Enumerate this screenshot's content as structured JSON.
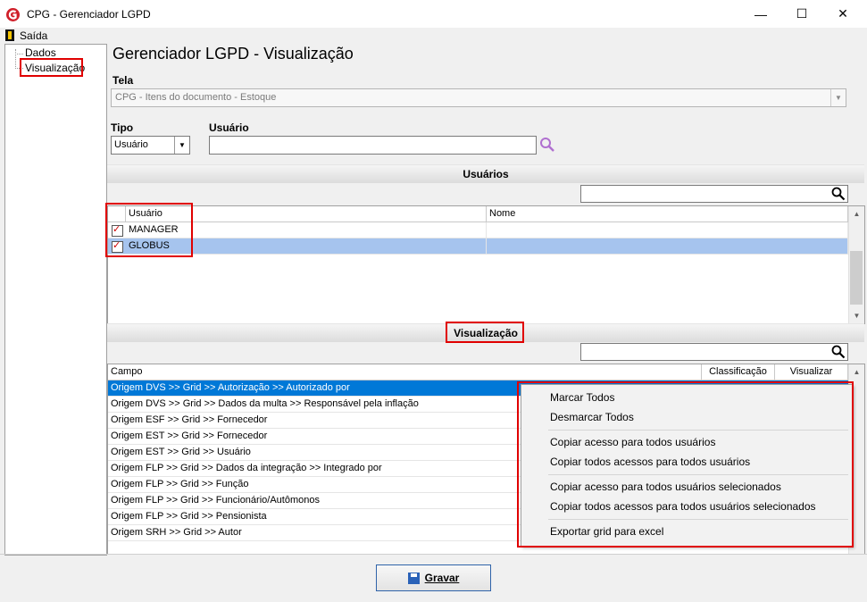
{
  "window": {
    "title": "CPG - Gerenciador LGPD",
    "minimize": "—",
    "maximize": "☐",
    "close": "✕"
  },
  "menu": {
    "saida": "Saída"
  },
  "tree": {
    "items": [
      {
        "label": "Dados"
      },
      {
        "label": "Visualização"
      }
    ]
  },
  "page": {
    "title": "Gerenciador LGPD - Visualização"
  },
  "tela": {
    "label": "Tela",
    "value": "CPG - Itens do documento - Estoque"
  },
  "tipo": {
    "label": "Tipo",
    "value": "Usuário"
  },
  "usuario": {
    "label": "Usuário",
    "value": ""
  },
  "usuarios_section": {
    "title": "Usuários",
    "search_value": "",
    "columns": [
      "Usuário",
      "Nome"
    ],
    "rows": [
      {
        "usuario": "MANAGER",
        "nome": "",
        "checked": true,
        "selected": false
      },
      {
        "usuario": "GLOBUS",
        "nome": "",
        "checked": true,
        "selected": true
      }
    ]
  },
  "visualizacao_section": {
    "title": "Visualização",
    "search_value": "",
    "columns": [
      "Campo",
      "Classificação",
      "Visualizar"
    ],
    "rows": [
      {
        "campo": "Origem DVS >> Grid >> Autorização >> Autorizado por"
      },
      {
        "campo": "Origem DVS >> Grid >> Dados da multa >> Responsável pela inflação"
      },
      {
        "campo": "Origem ESF >> Grid >> Fornecedor"
      },
      {
        "campo": "Origem EST >> Grid >> Fornecedor"
      },
      {
        "campo": "Origem EST >> Grid >> Usuário"
      },
      {
        "campo": "Origem FLP >> Grid >> Dados da integração >> Integrado por"
      },
      {
        "campo": "Origem FLP >> Grid >> Função"
      },
      {
        "campo": "Origem FLP >> Grid >> Funcionário/Autômonos"
      },
      {
        "campo": "Origem FLP >> Grid >> Pensionista"
      },
      {
        "campo": "Origem SRH >> Grid >> Autor"
      }
    ]
  },
  "context_menu": {
    "items": [
      "Marcar Todos",
      "Desmarcar Todos",
      "Copiar acesso para todos usuários",
      "Copiar todos acessos para todos usuários",
      "Copiar acesso para todos usuários selecionados",
      "Copiar todos acessos para todos usuários selecionados",
      "Exportar grid para excel"
    ]
  },
  "buttons": {
    "gravar": "Gravar"
  },
  "colors": {
    "selected_row": "#a6c4ee",
    "highlight_row": "#0078d7",
    "annotation": "#e00000",
    "logo": "#d0202a"
  }
}
